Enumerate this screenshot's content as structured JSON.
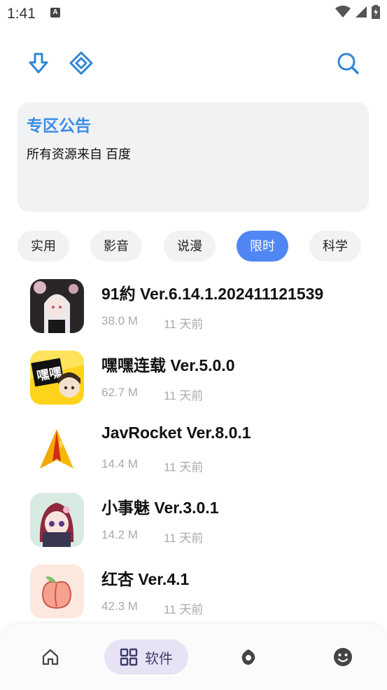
{
  "status_bar": {
    "time": "1:41",
    "notification_icon": "A"
  },
  "top_bar": {
    "icons": [
      "download-arrow-icon",
      "diamond-icon",
      "search-icon"
    ],
    "accent": "#3a8ee6"
  },
  "notice": {
    "title": "专区公告",
    "body": "所有资源来自 百度"
  },
  "categories": [
    {
      "label": "实用",
      "active": false
    },
    {
      "label": "影音",
      "active": false
    },
    {
      "label": "说漫",
      "active": false
    },
    {
      "label": "限时",
      "active": true
    },
    {
      "label": "科学",
      "active": false
    }
  ],
  "apps": [
    {
      "name": "91約 Ver.6.14.1.202411121539",
      "size": "38.0 M",
      "time": "11 天前",
      "icon": "anime-girl-icon"
    },
    {
      "name": "嘿嘿连载 Ver.5.0.0",
      "size": "62.7 M",
      "time": "11 天前",
      "icon": "heihei-comic-icon"
    },
    {
      "name": "JavRocket Ver.8.0.1",
      "size": "14.4 M",
      "time": "11 天前",
      "icon": "rocket-arrow-icon"
    },
    {
      "name": "小事魅 Ver.3.0.1",
      "size": "14.2 M",
      "time": "11 天前",
      "icon": "ninja-girl-icon"
    },
    {
      "name": "红杏 Ver.4.1",
      "size": "42.3 M",
      "time": "11 天前",
      "icon": "peach-icon"
    }
  ],
  "bottom_nav": {
    "items": [
      {
        "icon": "home-icon",
        "label": ""
      },
      {
        "icon": "grid-icon",
        "label": "软件"
      },
      {
        "icon": "compass-icon",
        "label": ""
      },
      {
        "icon": "smiley-icon",
        "label": ""
      }
    ],
    "active_color": "#e7e3f5"
  }
}
